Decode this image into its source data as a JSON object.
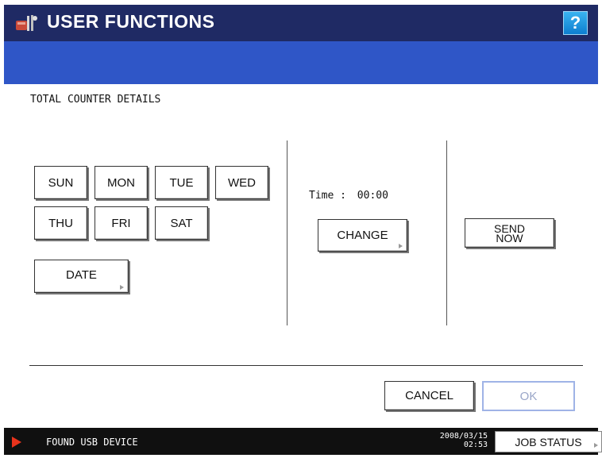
{
  "header": {
    "title": "USER FUNCTIONS",
    "help_label": "?",
    "icon": "user-functions-icon"
  },
  "screen": {
    "heading": "TOTAL COUNTER DETAILS"
  },
  "days": [
    {
      "label": "SUN"
    },
    {
      "label": "MON"
    },
    {
      "label": "TUE"
    },
    {
      "label": "WED"
    },
    {
      "label": "THU"
    },
    {
      "label": "FRI"
    },
    {
      "label": "SAT"
    }
  ],
  "date_button": "DATE",
  "time": {
    "label": "Time :",
    "value": "00:00",
    "change_label": "CHANGE"
  },
  "send_now": {
    "line1": "SEND",
    "line2": "NOW"
  },
  "footer": {
    "cancel_label": "CANCEL",
    "ok_label": "OK"
  },
  "statusbar": {
    "message": "FOUND USB DEVICE",
    "date": "2008/03/15",
    "time": "02:53",
    "job_status_label": "JOB STATUS",
    "alert_color": "#e8331c"
  },
  "colors": {
    "title_bar": "#1f2a64",
    "sub_bar": "#2f56c7",
    "help_button": "#1a94e0"
  }
}
